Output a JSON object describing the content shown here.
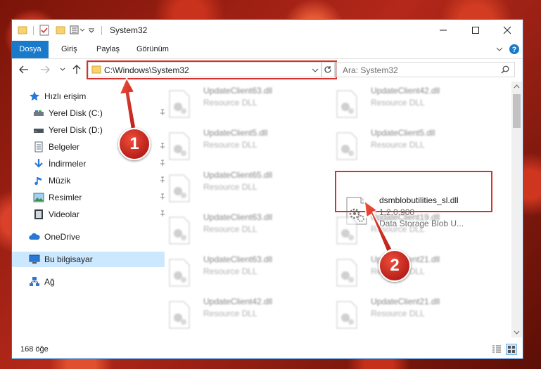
{
  "window": {
    "title": "System32",
    "minimize_label": "—",
    "maximize_label": "☐",
    "close_label": "✕"
  },
  "ribbon": {
    "tabs": [
      {
        "label": "Dosya"
      },
      {
        "label": "Giriş"
      },
      {
        "label": "Paylaş"
      },
      {
        "label": "Görünüm"
      }
    ]
  },
  "address": {
    "path": "C:\\Windows\\System32",
    "search_placeholder": "Ara: System32"
  },
  "sidebar": {
    "items": [
      {
        "label": "Hızlı erişim",
        "icon": "star-icon"
      },
      {
        "label": "Yerel Disk (C:)",
        "icon": "drive-icon"
      },
      {
        "label": "Yerel Disk (D:)",
        "icon": "drive-icon"
      },
      {
        "label": "Belgeler",
        "icon": "documents-icon"
      },
      {
        "label": "İndirmeler",
        "icon": "download-icon"
      },
      {
        "label": "Müzik",
        "icon": "music-icon"
      },
      {
        "label": "Resimler",
        "icon": "pictures-icon"
      },
      {
        "label": "Videolar",
        "icon": "videos-icon"
      },
      {
        "label": "OneDrive",
        "icon": "cloud-icon"
      },
      {
        "label": "Bu bilgisayar",
        "icon": "computer-icon"
      },
      {
        "label": "Ağ",
        "icon": "network-icon"
      }
    ]
  },
  "files": {
    "left": [
      {
        "name": "UpdateClient63.dll",
        "desc": "Resource DLL"
      },
      {
        "name": "UpdateClient5.dll",
        "desc": "Resource DLL"
      },
      {
        "name": "UpdateClient65.dll",
        "desc": "Resource DLL"
      },
      {
        "name": "UpdateClient63.dll",
        "desc": "Resource DLL"
      },
      {
        "name": "UpdateClient63.dll",
        "desc": "Resource DLL"
      },
      {
        "name": "UpdateClient42.dll",
        "desc": "Resource DLL"
      }
    ],
    "right": [
      {
        "name": "UpdateClient42.dll",
        "desc": "Resource DLL"
      },
      {
        "name": "UpdateClient5.dll",
        "desc": "Resource DLL"
      },
      {
        "name": "UpdateClient19.dll",
        "desc": "Resource DLL"
      },
      {
        "name": "UpdateClient21.dll",
        "desc": "Resource DLL"
      },
      {
        "name": "UpdateClient21.dll",
        "desc": "Resource DLL"
      }
    ],
    "highlighted": {
      "name": "dsmblobutilities_sl.dll",
      "version": "1.2.0.900",
      "desc": "Data Storage Blob U..."
    }
  },
  "status": {
    "count": "168 öğe"
  },
  "callouts": {
    "one": "1",
    "two": "2"
  },
  "colors": {
    "accent": "#1979ca",
    "highlight": "#d9302c",
    "selection": "#cce8ff"
  }
}
